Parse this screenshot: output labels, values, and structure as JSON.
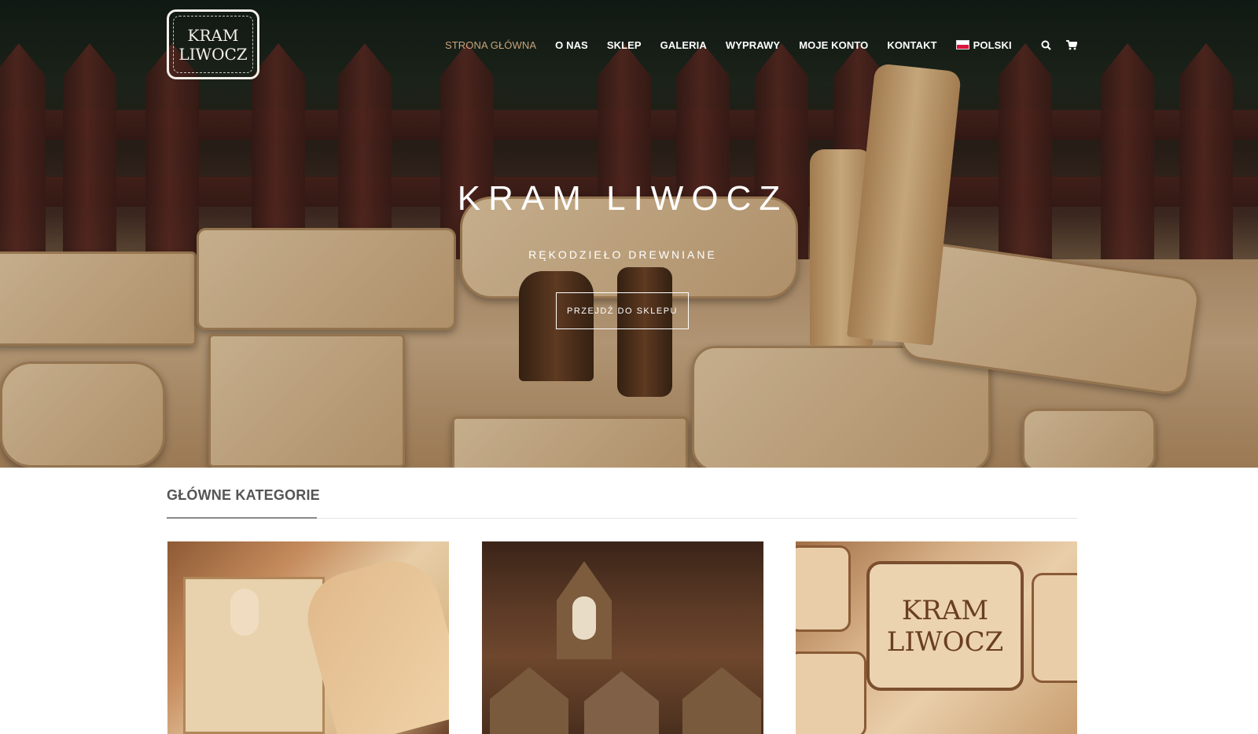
{
  "logo": {
    "line1": "KRAM",
    "line2": "LIWOCZ"
  },
  "nav": {
    "items": [
      {
        "label": "STRONA GŁÓWNA",
        "active": true
      },
      {
        "label": "O NAS",
        "active": false
      },
      {
        "label": "SKLEP",
        "active": false
      },
      {
        "label": "GALERIA",
        "active": false
      },
      {
        "label": "WYPRAWY",
        "active": false
      },
      {
        "label": "MOJE KONTO",
        "active": false
      },
      {
        "label": "KONTAKT",
        "active": false
      }
    ],
    "language": "POLSKI",
    "search_icon": "search-icon",
    "cart_icon": "cart-icon",
    "active_color": "#c8a37c"
  },
  "hero": {
    "title": "KRAM LIWOCZ",
    "subtitle": "RĘKODZIEŁO DREWNIANE",
    "button_label": "PRZEJDŹ DO SKLEPU"
  },
  "categories": {
    "title": "GŁÓWNE KATEGORIE",
    "card3_text_line1": "KRAM",
    "card3_text_line2": "LIWOCZ"
  }
}
